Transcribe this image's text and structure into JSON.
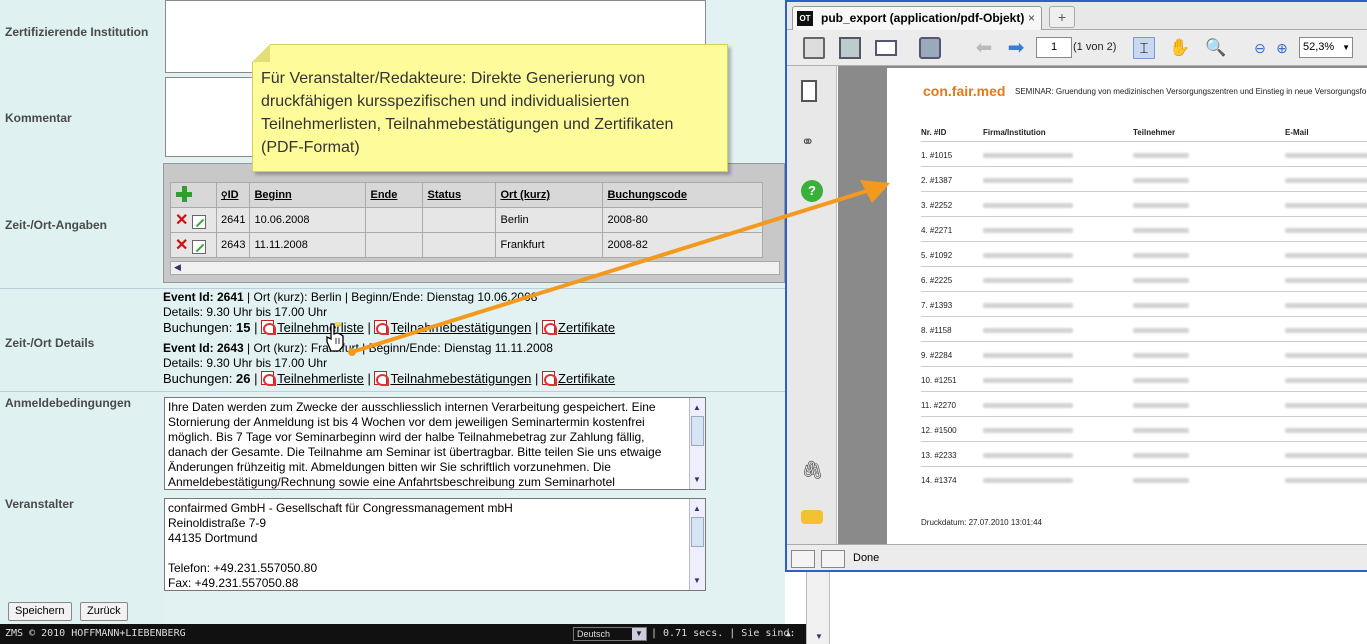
{
  "form": {
    "labels": {
      "institution": "Zertifizierende Institution",
      "comment": "Kommentar",
      "time_place": "Zeit-/Ort-Angaben",
      "time_place_details": "Zeit-/Ort Details",
      "conditions": "Anmeldebedingungen",
      "organizer": "Veranstalter"
    },
    "table": {
      "headers": [
        "ID",
        "Beginn",
        "Ende",
        "Status",
        "Ort (kurz)",
        "Buchungscode"
      ],
      "rows": [
        {
          "id": "2641",
          "beginn": "10.06.2008",
          "ende": "",
          "status": "",
          "ort": "Berlin",
          "code": "2008-80"
        },
        {
          "id": "2643",
          "beginn": "11.11.2008",
          "ende": "",
          "status": "",
          "ort": "Frankfurt",
          "code": "2008-82"
        }
      ]
    },
    "events": [
      {
        "id_label": "Event Id: 2641",
        "info": " | Ort (kurz): Berlin | Beginn/Ende: Dienstag 10.06.2008",
        "details": "Details: 9.30 Uhr bis 17.00 Uhr",
        "bookings_label": "Buchungen: ",
        "bookings": "15",
        "links": [
          "Teilnehmerliste",
          "Teilnahmebestätigungen",
          "Zertifikate"
        ]
      },
      {
        "id_label": "Event Id: 2643",
        "info": " | Ort (kurz): Frankfurt | Beginn/Ende: Dienstag 11.11.2008",
        "details": "Details: 9.30 Uhr bis 17.00 Uhr",
        "bookings_label": "Buchungen: ",
        "bookings": "26",
        "links": [
          "Teilnehmerliste",
          "Teilnahmebestätigungen",
          "Zertifikate"
        ]
      }
    ],
    "conditions_text": "Ihre Daten werden zum Zwecke der ausschliesslich internen Verarbeitung gespeichert. Eine Stornierung der Anmeldung ist bis 4 Wochen vor dem jeweiligen Seminartermin kostenfrei möglich. Bis 7 Tage vor Seminarbeginn wird der halbe Teilnahmebetrag zur Zahlung fällig, danach der Gesamte. Die Teilnahme am Seminar ist übertragbar. Bitte teilen Sie uns etwaige Änderungen frühzeitig mit. Abmeldungen bitten wir Sie schriftlich vorzunehmen. Die Anmeldebestätigung/Rechnung sowie eine Anfahrtsbeschreibung zum Seminarhotel",
    "organizer_lines": [
      "confairmed GmbH - Gesellschaft für Congressmanagement mbH",
      "Reinoldistraße 7-9",
      "44135 Dortmund",
      "",
      "Telefon: +49.231.557050.80",
      "Fax: +49.231.557050.88"
    ],
    "buttons": {
      "save": "Speichern",
      "back": "Zurück"
    }
  },
  "statusbar": {
    "left": "ZMS © 2010 HOFFMANN+LIEBENBERG",
    "language": "Deutsch",
    "right": "| 0.71 secs. | Sie sind: fox |"
  },
  "note": {
    "text": "Für Veranstalter/Redakteure: Direkte Generierung von druckfähigen kursspezifischen und individualisierten Teilnehmerlisten, Teilnahmebestätigungen und Zertifikaten (PDF-Format)"
  },
  "pdf": {
    "tab_icon": "OT",
    "tab_title": "pub_export (application/pdf-Objekt)",
    "tab_close": "×",
    "new_tab": "+",
    "page_input": "1",
    "page_of": "(1 von 2)",
    "zoom": "52,3%",
    "status": "Done",
    "doc": {
      "logo": "con.fair.med",
      "seminar": "SEMINAR: Gruendung von medizinischen Versorgungszentren und Einstieg in neue Versorgungsfo",
      "headers": [
        "Nr. #ID",
        "Firma/Institution",
        "Teilnehmer",
        "E-Mail"
      ],
      "rows": [
        "1. #1015",
        "2. #1387",
        "3. #2252",
        "4. #2271",
        "5. #1092",
        "6. #2225",
        "7. #1393",
        "8. #1158",
        "9. #2284",
        "10. #1251",
        "11. #2270",
        "12. #1500",
        "13. #2233",
        "14. #1374"
      ],
      "footer": "Druckdatum: 27.07.2010 13:01:44"
    }
  },
  "colors": {
    "accent_arrow": "#f39a1e",
    "note_bg": "#fefc9a",
    "window_border": "#2e5fc8",
    "logo": "#e07a1a"
  }
}
